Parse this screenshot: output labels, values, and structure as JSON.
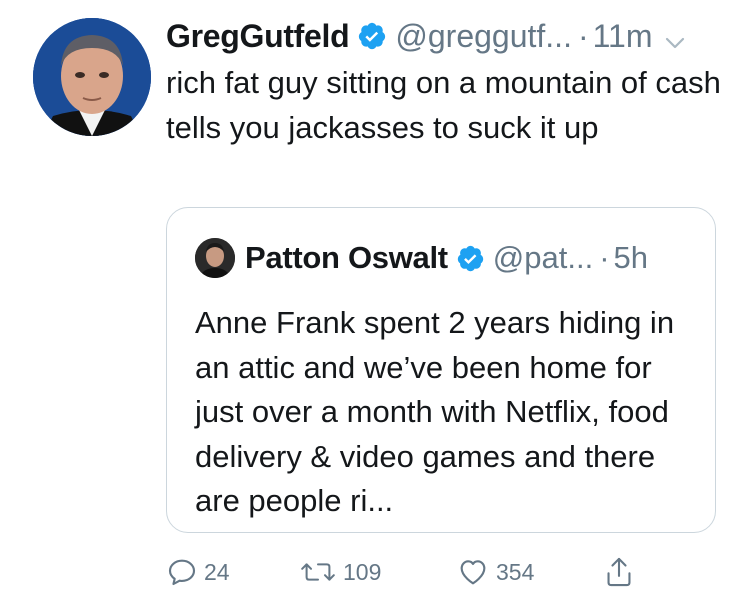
{
  "tweet": {
    "author_name": "GregGutfeld",
    "handle": "@greggutf...",
    "separator": "·",
    "time": "11m",
    "text": "rich fat guy sitting on a mountain of cash tells you jackasses to suck it up",
    "verified": true
  },
  "quoted_tweet": {
    "author_name": "Patton Oswalt",
    "handle": "@pat...",
    "separator": "·",
    "time": "5h",
    "text": "Anne Frank spent 2 years hiding in an attic and we’ve been home for just over a month with Netflix, food delivery & video games and there are people ri...",
    "verified": true
  },
  "actions": {
    "reply_count": "24",
    "retweet_count": "109",
    "like_count": "354"
  },
  "colors": {
    "verified": "#1da1f2",
    "secondary_text": "#657786",
    "border": "#ccd6dd"
  },
  "icons": {
    "reply": "reply-icon",
    "retweet": "retweet-icon",
    "like": "heart-icon",
    "share": "share-icon",
    "verified": "verified-badge-icon",
    "caret": "chevron-down-icon"
  }
}
